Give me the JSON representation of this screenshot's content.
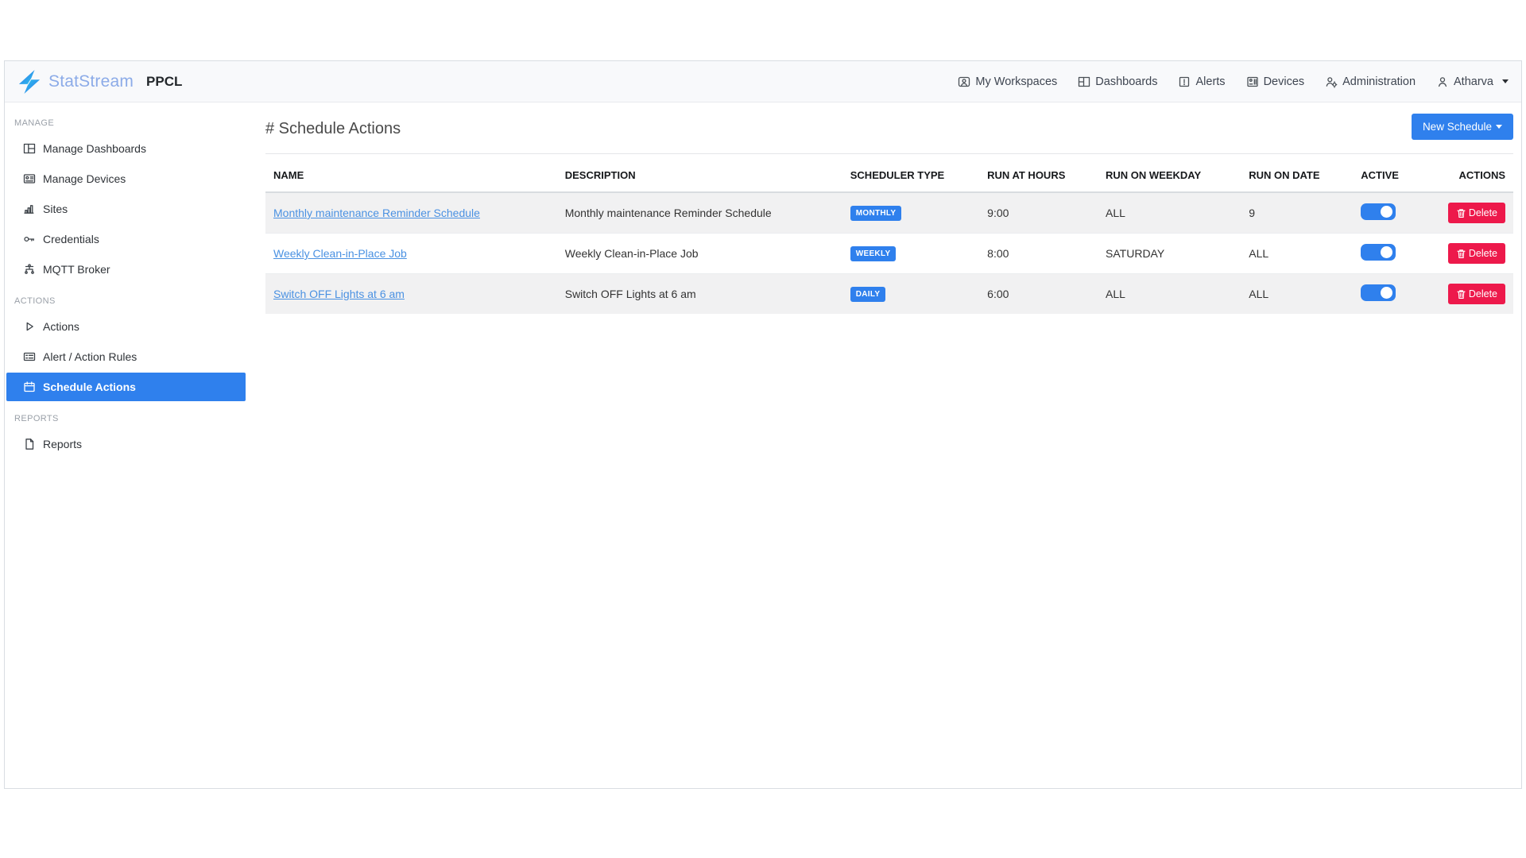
{
  "brand": {
    "logo_icon": "statstream-logo-icon",
    "name": "StatStream",
    "workspace": "PPCL"
  },
  "top_nav": {
    "items": [
      {
        "label": "My Workspaces",
        "icon": "workspaces-icon"
      },
      {
        "label": "Dashboards",
        "icon": "dashboards-icon"
      },
      {
        "label": "Alerts",
        "icon": "alerts-icon"
      },
      {
        "label": "Devices",
        "icon": "devices-icon"
      },
      {
        "label": "Administration",
        "icon": "administration-icon"
      }
    ],
    "user": {
      "label": "Atharva",
      "icon": "user-icon",
      "caret": "caret-down-icon"
    }
  },
  "sidebar": {
    "sections": [
      {
        "title": "MANAGE",
        "items": [
          {
            "label": "Manage Dashboards",
            "icon": "manage-dashboards-icon",
            "active": false
          },
          {
            "label": "Manage Devices",
            "icon": "manage-devices-icon",
            "active": false
          },
          {
            "label": "Sites",
            "icon": "sites-icon",
            "active": false
          },
          {
            "label": "Credentials",
            "icon": "credentials-icon",
            "active": false
          },
          {
            "label": "MQTT Broker",
            "icon": "mqtt-broker-icon",
            "active": false
          }
        ]
      },
      {
        "title": "ACTIONS",
        "items": [
          {
            "label": "Actions",
            "icon": "actions-icon",
            "active": false
          },
          {
            "label": "Alert / Action Rules",
            "icon": "alert-action-rules-icon",
            "active": false
          },
          {
            "label": "Schedule Actions",
            "icon": "schedule-actions-icon",
            "active": true
          }
        ]
      },
      {
        "title": "REPORTS",
        "items": [
          {
            "label": "Reports",
            "icon": "reports-icon",
            "active": false
          }
        ]
      }
    ]
  },
  "main": {
    "title": "# Schedule Actions",
    "new_schedule_button": {
      "label": "New Schedule",
      "icon": "caret-down-icon"
    },
    "table": {
      "headers": [
        "NAME",
        "DESCRIPTION",
        "SCHEDULER TYPE",
        "RUN AT HOURS",
        "RUN ON WEEKDAY",
        "RUN ON DATE",
        "ACTIVE",
        "ACTIONS"
      ],
      "delete_label": "Delete",
      "delete_icon": "trash-icon",
      "rows": [
        {
          "name": "Monthly maintenance Reminder Schedule",
          "description": "Monthly maintenance Reminder Schedule",
          "scheduler_type": "MONTHLY",
          "run_at_hours": "9:00",
          "run_on_weekday": "ALL",
          "run_on_date": "9",
          "active": true
        },
        {
          "name": "Weekly Clean-in-Place Job",
          "description": "Weekly Clean-in-Place Job",
          "scheduler_type": "WEEKLY",
          "run_at_hours": "8:00",
          "run_on_weekday": "SATURDAY",
          "run_on_date": "ALL",
          "active": true
        },
        {
          "name": "Switch OFF Lights at 6 am",
          "description": "Switch OFF Lights at 6 am",
          "scheduler_type": "DAILY",
          "run_at_hours": "6:00",
          "run_on_weekday": "ALL",
          "run_on_date": "ALL",
          "active": true
        }
      ]
    }
  },
  "colors": {
    "primary": "#2f80ed",
    "danger": "#ed194b",
    "link": "#4a91e2",
    "brand_text": "#8cabe8",
    "logo_blue": "#2f6fe8",
    "logo_cyan": "#2ec5ee",
    "row_stripe": "#f1f1f2"
  }
}
